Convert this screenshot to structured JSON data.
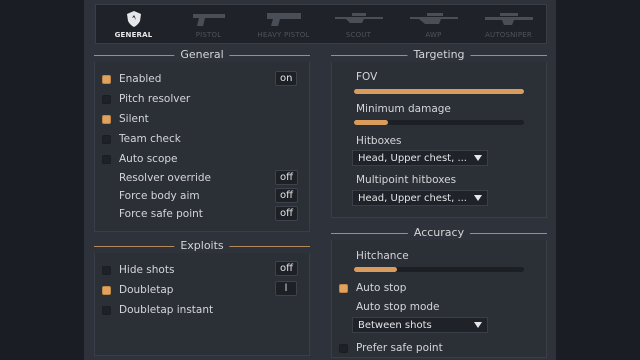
{
  "tabs": [
    {
      "label": "GENERAL",
      "icon": "shield-icon",
      "active": true
    },
    {
      "label": "PISTOL",
      "icon": "pistol-icon",
      "active": false
    },
    {
      "label": "HEAVY PISTOL",
      "icon": "heavy-pistol-icon",
      "active": false
    },
    {
      "label": "SCOUT",
      "icon": "scout-rifle-icon",
      "active": false
    },
    {
      "label": "AWP",
      "icon": "awp-rifle-icon",
      "active": false
    },
    {
      "label": "AUTOSNIPER",
      "icon": "autosniper-icon",
      "active": false
    }
  ],
  "general": {
    "title": "General",
    "enabled": {
      "label": "Enabled",
      "checked": true,
      "key": "on"
    },
    "pitch_resolver": {
      "label": "Pitch resolver",
      "checked": false
    },
    "silent": {
      "label": "Silent",
      "checked": true
    },
    "team_check": {
      "label": "Team check",
      "checked": false
    },
    "auto_scope": {
      "label": "Auto scope",
      "checked": false
    },
    "resolver_override": {
      "label": "Resolver override",
      "key": "off"
    },
    "force_body_aim": {
      "label": "Force body aim",
      "key": "off"
    },
    "force_safe_point": {
      "label": "Force safe point",
      "key": "off"
    }
  },
  "exploits": {
    "title": "Exploits",
    "hide_shots": {
      "label": "Hide shots",
      "checked": false,
      "key": "off"
    },
    "doubletap": {
      "label": "Doubletap",
      "checked": true,
      "key": "l"
    },
    "doubletap_instant": {
      "label": "Doubletap instant",
      "checked": false
    }
  },
  "targeting": {
    "title": "Targeting",
    "fov": {
      "label": "FOV",
      "fraction": 1.0
    },
    "min_damage": {
      "label": "Minimum damage",
      "fraction": 0.2
    },
    "hitboxes": {
      "label": "Hitboxes",
      "value": "Head, Upper chest, ..."
    },
    "multipoint": {
      "label": "Multipoint hitboxes",
      "value": "Head, Upper chest, ..."
    }
  },
  "accuracy": {
    "title": "Accuracy",
    "hitchance": {
      "label": "Hitchance",
      "fraction": 0.25
    },
    "auto_stop": {
      "label": "Auto stop",
      "checked": true
    },
    "auto_stop_mode": {
      "label": "Auto stop mode",
      "value": "Between shots"
    },
    "prefer_safe_point": {
      "label": "Prefer safe point",
      "checked": false
    }
  },
  "colors": {
    "accent": "#d99c5c",
    "background": "#2e323a",
    "panel": "#2b2f36"
  }
}
